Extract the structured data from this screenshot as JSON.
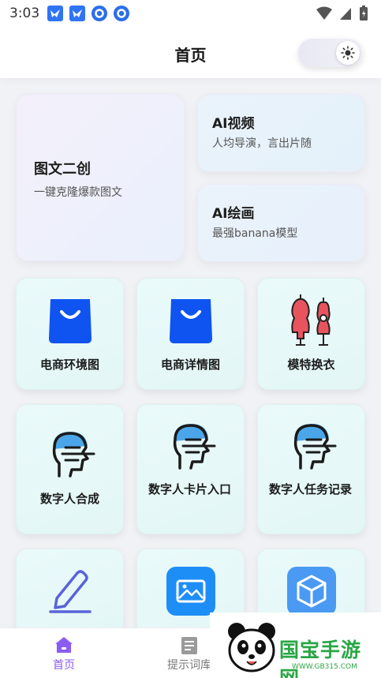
{
  "status_bar": {
    "time": "3:03"
  },
  "header": {
    "title": "首页"
  },
  "feature_cards": [
    {
      "title": "图文二创",
      "subtitle": "一键克隆爆款图文"
    },
    {
      "title": "AI视频",
      "subtitle": "人均导演，言出片随"
    },
    {
      "title": "AI绘画",
      "subtitle": "最强banana模型"
    }
  ],
  "tiles": [
    {
      "label": "电商环境图",
      "icon": "shopping-bag-icon"
    },
    {
      "label": "电商详情图",
      "icon": "shopping-bag-icon"
    },
    {
      "label": "模特换衣",
      "icon": "mannequin-icon"
    },
    {
      "label": "数字人合成",
      "icon": "digital-human-icon"
    },
    {
      "label": "数字人卡片入口",
      "icon": "digital-human-icon"
    },
    {
      "label": "数字人任务记录",
      "icon": "digital-human-icon"
    },
    {
      "label": "",
      "icon": "pencil-icon"
    },
    {
      "label": "",
      "icon": "image-icon"
    },
    {
      "label": "",
      "icon": "cube-icon"
    }
  ],
  "bottom_nav": [
    {
      "label": "首页",
      "icon": "home-icon",
      "active": true
    },
    {
      "label": "提示词库",
      "icon": "document-icon",
      "active": false
    }
  ],
  "watermark": {
    "text": "国宝手游网",
    "url": "WWW.GB315.COM"
  },
  "colors": {
    "accent": "#8a5cf0",
    "bag_blue": "#0f53f0",
    "human_blue": "#4aa6e8",
    "app_blue": "#1e8ef7",
    "watermark_green": "#2aa645"
  }
}
